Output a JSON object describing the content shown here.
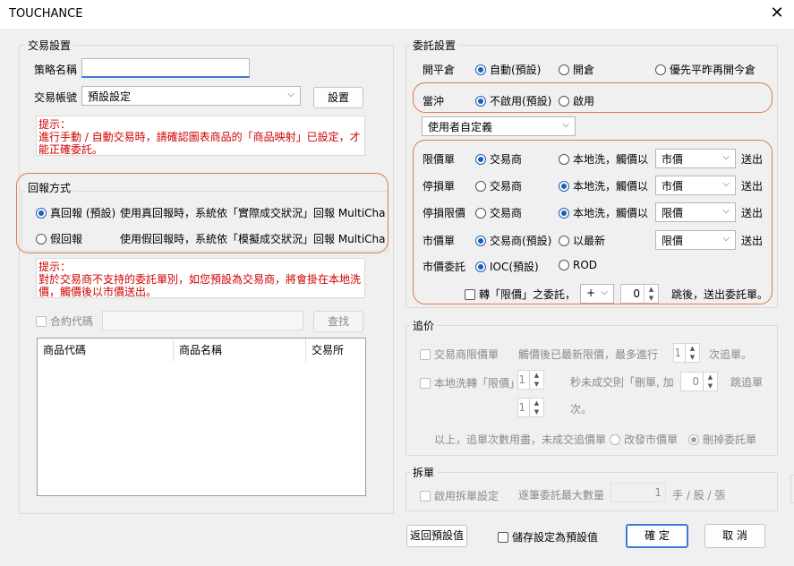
{
  "window": {
    "title": "TOUCHANCE"
  },
  "trade_settings": {
    "group_title": "交易設置",
    "strategy_label": "策略名稱",
    "strategy_value": "",
    "account_label": "交易帳號",
    "account_value": "預設設定",
    "settings_button": "設置",
    "tip_title": "提示：",
    "tip_body": "進行手動 / 自動交易時，請確認圖表商品的「商品映射」已設定，才能正確委託。"
  },
  "report_mode": {
    "group_title": "回報方式",
    "options": [
      {
        "label": "真回報 (預設)",
        "desc": "使用真回報時，系統依「實際成交狀況」回報 MultiCharts",
        "selected": true
      },
      {
        "label": "假回報",
        "desc": "使用假回報時，系統依「模擬成交狀況」回報 MultiCharts",
        "selected": false
      }
    ],
    "tip_title": "提示：",
    "tip_body": "對於交易商不支持的委託單別，如您預設為交易商，將會掛在本地洗價，觸價後以市價送出。"
  },
  "contract": {
    "checkbox_label": "合約代碼",
    "search_button": "查找",
    "columns": [
      "商品代碼",
      "商品名稱",
      "交易所"
    ]
  },
  "order_settings": {
    "group_title": "委託設置",
    "open_close_label": "開平倉",
    "open_close_options": [
      "自動(預設)",
      "開倉",
      "優先平昨再開今倉"
    ],
    "hedge_label": "當沖",
    "hedge_options": [
      "不啟用(預設)",
      "啟用"
    ],
    "custom_select": "使用者自定義",
    "rows": [
      {
        "label": "限價單",
        "opt1": "交易商",
        "opt2": "本地洗，觸價以",
        "sel": 1,
        "select": "市價",
        "suffix": "送出"
      },
      {
        "label": "停損單",
        "opt1": "交易商",
        "opt2": "本地洗，觸價以",
        "sel": 2,
        "select": "市價",
        "suffix": "送出"
      },
      {
        "label": "停損限價",
        "opt1": "交易商",
        "opt2": "本地洗，觸價以",
        "sel": 2,
        "select": "限價",
        "suffix": "送出"
      },
      {
        "label": "市價單",
        "opt1": "交易商(預設)",
        "opt2": "以最新",
        "sel": 1,
        "select": "限價",
        "suffix": "送出"
      }
    ],
    "market_order_label": "市價委託",
    "market_order_options": [
      "IOC(預設)",
      "ROD"
    ],
    "convert_label": "轉「限價」之委託，",
    "convert_sign": "+",
    "convert_ticks": "0",
    "convert_suffix": "跳後，送出委託單。"
  },
  "chase": {
    "group_title": "追价",
    "broker_label": "交易商限價單",
    "broker_desc": "觸價後已最新限價，最多進行",
    "broker_count": "1",
    "broker_unit": "次追單。",
    "local_label": "本地洗轉「限價」",
    "local_sec": "1",
    "local_desc": "秒未成交則「刪單, 加",
    "local_ticks": "0",
    "local_unit": "跳追單",
    "local_times": "1",
    "local_times_unit": "次。",
    "exhausted": "以上，追單次數用盡，未成交追價單",
    "exhausted_opt1": "改發市價單",
    "exhausted_opt2": "刪掉委託單"
  },
  "split": {
    "group_title": "拆單",
    "enable_label": "啟用拆單設定",
    "max_label": "逐筆委託最大數量",
    "max_value": "1",
    "unit": "手 / 股 / 張"
  },
  "footer": {
    "reset_button": "返回預設值",
    "save_default_label": "儲存設定為預設值",
    "ok_button": "確 定",
    "cancel_button": "取 消"
  }
}
